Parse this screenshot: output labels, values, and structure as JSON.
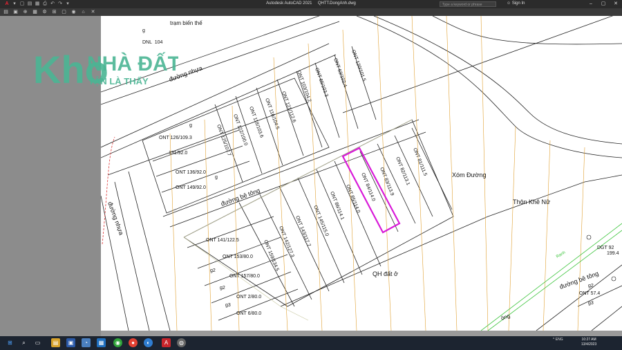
{
  "app": {
    "title": "Autodesk AutoCAD 2021",
    "file": "QHTT.DongAnh.dwg",
    "search_placeholder": "Type a keyword or phrase",
    "sign_in": "Sign In",
    "help": "?",
    "accent": "#e3252b"
  },
  "quick_access": [
    "A",
    "▾",
    "▢",
    "▤",
    "▦",
    "⎙",
    "↶",
    "↷",
    "▾"
  ],
  "toolbar_icons": [
    "▤",
    "▣",
    "⊕",
    "▦",
    "⚙",
    "⊞",
    "▢",
    "◉",
    "⌂",
    "✕"
  ],
  "watermark": {
    "logo_text": "Kho",
    "brand": "NHÀ ĐẤT",
    "slogan": "TẬN LÀ THẤY",
    "color": "#4ab594"
  },
  "map": {
    "top_label": "trạm biến thế",
    "road_asphalt_top": "đường nhựa",
    "road_asphalt_left": "đường nhựa",
    "road_concrete": "đường bê tông",
    "road_concrete_right": "đường bê tông",
    "road_fragment": "ông",
    "area_xom_duong": "Xóm Đường",
    "area_thon_khe_nu": "Thôn Khê Nữ",
    "zone_qh": "QH đất ở",
    "green_label": "Ranh",
    "highlight_color": "#d81ad8",
    "top_left_parcel": {
      "code": "DNL",
      "num": "104",
      "area": "...",
      "g": "g"
    },
    "parcels_upper_row": [
      {
        "code": "ONT",
        "num": "120",
        "area": "101.5"
      },
      {
        "code": "ONT",
        "num": "63",
        "area": "102.4"
      },
      {
        "code": "ONT",
        "num": "65",
        "area": "103.3"
      },
      {
        "code": "ONT",
        "num": "103",
        "area": "104.2"
      },
      {
        "code": "ONT",
        "num": "121",
        "area": "112.6"
      },
      {
        "code": "ONT",
        "num": "116",
        "area": "104.5"
      },
      {
        "code": "ONT",
        "num": "118",
        "area": "103.6"
      },
      {
        "code": "ONT",
        "num": "122",
        "area": "100.0"
      },
      {
        "code": "ONT",
        "num": "125",
        "area": "107.7"
      }
    ],
    "parcels_left_block": [
      {
        "code": "ONT",
        "num": "126",
        "area": "109.3"
      },
      {
        "code": "",
        "num": "131",
        "area": "92.0"
      },
      {
        "code": "ONT",
        "num": "136",
        "area": "92.0"
      },
      {
        "code": "ONT",
        "num": "149",
        "area": "92.0"
      }
    ],
    "parcels_mid_row": [
      {
        "code": "ONT",
        "num": "84",
        "area": "114.0",
        "highlight": true
      },
      {
        "code": "ONT",
        "num": "83",
        "area": "113.9"
      },
      {
        "code": "ONT",
        "num": "82",
        "area": "113.1"
      },
      {
        "code": "ONT",
        "num": "81",
        "area": "111.5"
      },
      {
        "code": "ONT",
        "num": "85",
        "area": "114.0"
      },
      {
        "code": "ONT",
        "num": "86",
        "area": "114.1"
      },
      {
        "code": "ONT",
        "num": "145",
        "area": "115.0"
      },
      {
        "code": "ONT",
        "num": "143",
        "area": "117.7"
      },
      {
        "code": "ONT",
        "num": "142",
        "area": "127.3"
      },
      {
        "code": "ONT",
        "num": "159",
        "area": "134.5"
      }
    ],
    "parcels_lower_block": [
      {
        "code": "ONT",
        "num": "141",
        "area": "122.5"
      },
      {
        "code": "ONT",
        "num": "153",
        "area": "80.0"
      },
      {
        "code": "ONT",
        "num": "157",
        "area": "80.0"
      },
      {
        "code": "ONT",
        "num": "2",
        "area": "80.0"
      },
      {
        "code": "ONT",
        "num": "6",
        "area": "80.0"
      }
    ],
    "g_marks": [
      "g",
      "g2",
      "g2",
      "g3",
      "g",
      "g"
    ],
    "dgt": {
      "code": "DGT",
      "num": "92",
      "area": "199.4"
    },
    "right_parcel": {
      "code": "ONT",
      "num": "...",
      "area": "57.4",
      "g2": "g2",
      "g3": "g3"
    }
  },
  "taskbar": {
    "language": "ENG",
    "time": "10:27 AM",
    "date": "13/4/2023",
    "icons": [
      "⊞",
      "⌕",
      "▭",
      "▤",
      "▣",
      "◔",
      "▦",
      "◉",
      "●",
      "◐",
      "A",
      "◍"
    ]
  }
}
